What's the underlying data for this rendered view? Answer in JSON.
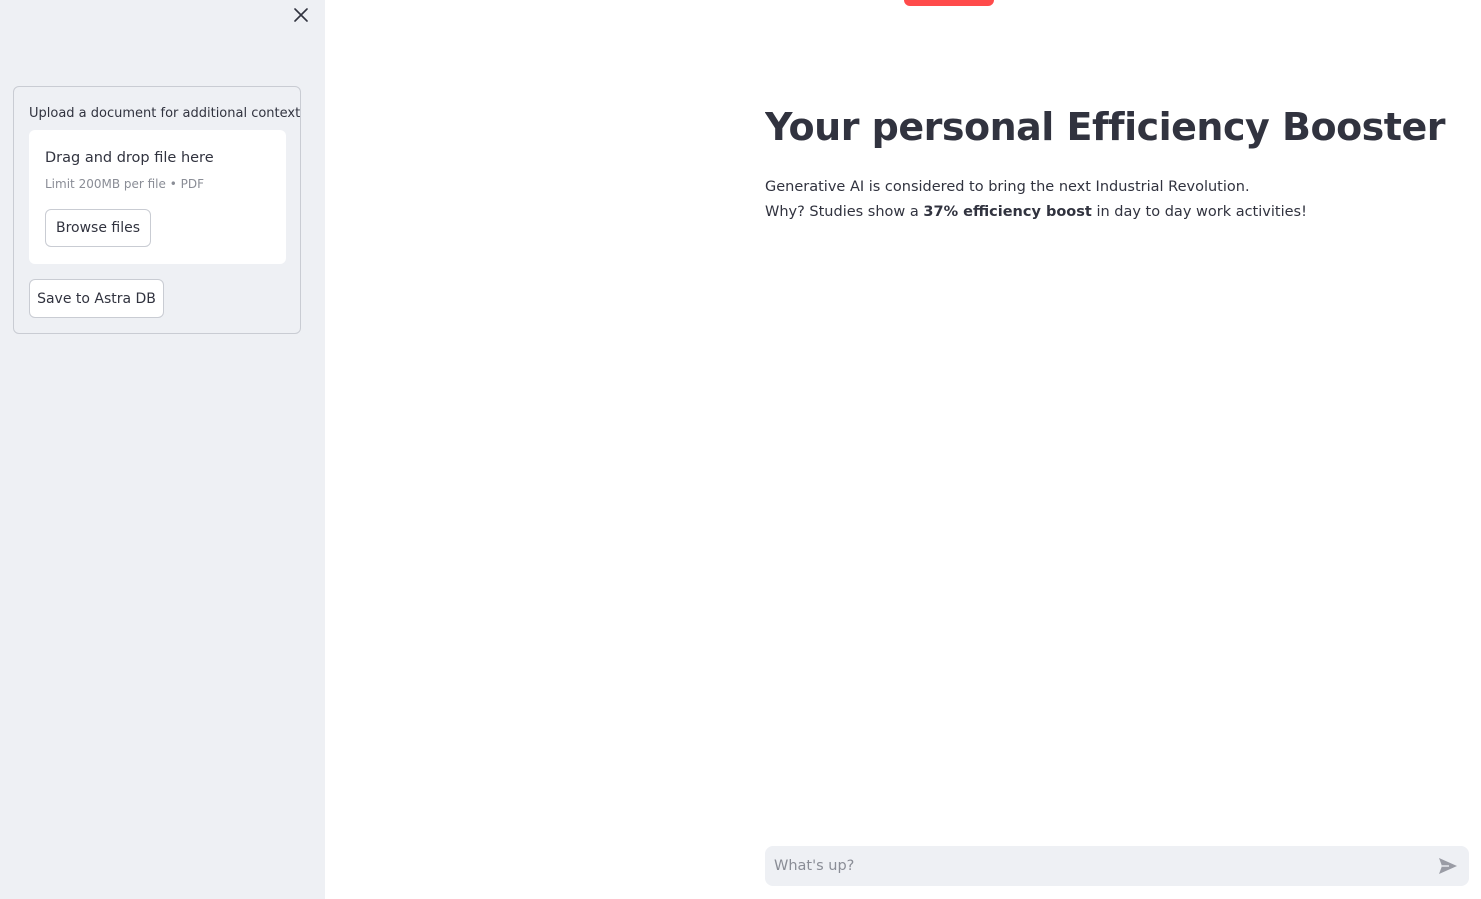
{
  "sidebar": {
    "upload_label": "Upload a document for additional context",
    "dropzone_title": "Drag and drop file here",
    "dropzone_limit": "Limit 200MB per file • PDF",
    "browse_label": "Browse files",
    "save_label": "Save to Astra DB",
    "close_icon": "close-icon"
  },
  "main": {
    "title": "Your personal Efficiency Booster",
    "intro_line1": "Generative AI is considered to bring the next Industrial Revolution.",
    "intro_line2_prefix": "Why? Studies show a ",
    "intro_line2_bold": "37% efficiency boost",
    "intro_line2_suffix": " in day to day work activities!"
  },
  "chat": {
    "placeholder": "What's up?",
    "send_icon": "send-icon"
  },
  "colors": {
    "sidebar_bg": "#eef0f4",
    "accent": "#ff4b4b",
    "text": "#31333f"
  }
}
